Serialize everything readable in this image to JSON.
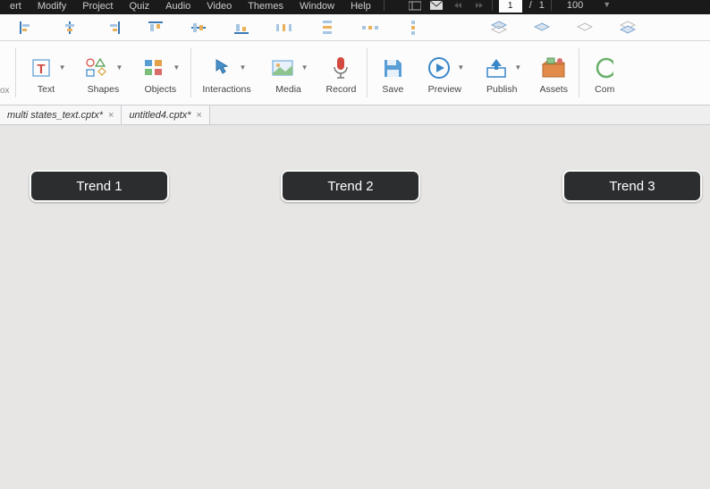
{
  "menubar": {
    "items": [
      "ert",
      "Modify",
      "Project",
      "Quiz",
      "Audio",
      "Video",
      "Themes",
      "Window",
      "Help"
    ],
    "page_current": "1",
    "page_total": "1",
    "zoom": "100"
  },
  "ribbon": {
    "ox_label": "ox",
    "text": "Text",
    "shapes": "Shapes",
    "objects": "Objects",
    "interactions": "Interactions",
    "media": "Media",
    "record": "Record",
    "save": "Save",
    "preview": "Preview",
    "publish": "Publish",
    "assets": "Assets",
    "com": "Com"
  },
  "tabs": [
    {
      "name": "multi states_text.cptx*"
    },
    {
      "name": "untitled4.cptx*"
    }
  ],
  "canvas": {
    "trend1": "Trend 1",
    "trend2": "Trend 2",
    "trend3": "Trend 3"
  }
}
